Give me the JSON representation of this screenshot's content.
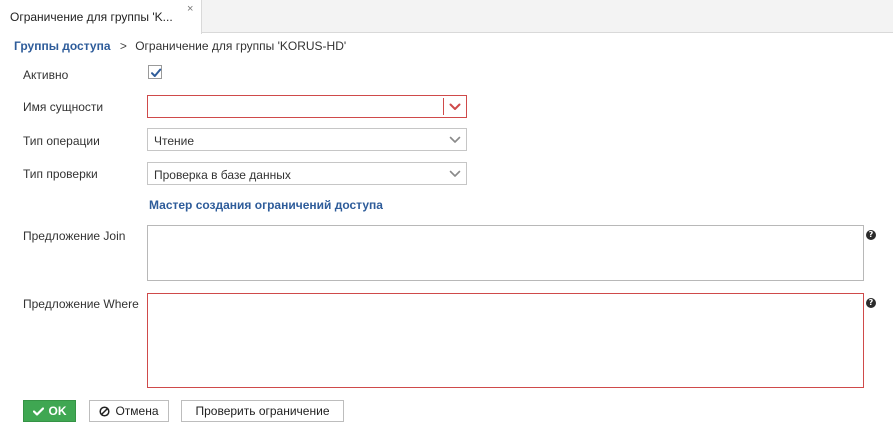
{
  "tab": {
    "title": "Ограничение для группы 'K...",
    "close_symbol": "×"
  },
  "breadcrumb": {
    "parent": "Группы доступа",
    "separator": ">",
    "current": "Ограничение для группы 'KORUS-HD'"
  },
  "form": {
    "active": {
      "label": "Активно",
      "checked": true
    },
    "entity_name": {
      "label": "Имя сущности",
      "value": "",
      "error": true
    },
    "operation_type": {
      "label": "Тип операции",
      "value": "Чтение"
    },
    "check_type": {
      "label": "Тип проверки",
      "value": "Проверка в базе данных"
    },
    "wizard_link": "Мастер создания ограничений доступа",
    "join_clause": {
      "label": "Предложение Join",
      "value": "",
      "help_symbol": "?"
    },
    "where_clause": {
      "label": "Предложение Where",
      "value": "",
      "error": true,
      "help_symbol": "?"
    }
  },
  "buttons": {
    "ok": "OK",
    "cancel": "Отмена",
    "check_constraint": "Проверить ограничение"
  },
  "colors": {
    "accent_link": "#2e5c9a",
    "ok_button": "#3fa752",
    "error_border": "#cf4a4a"
  }
}
